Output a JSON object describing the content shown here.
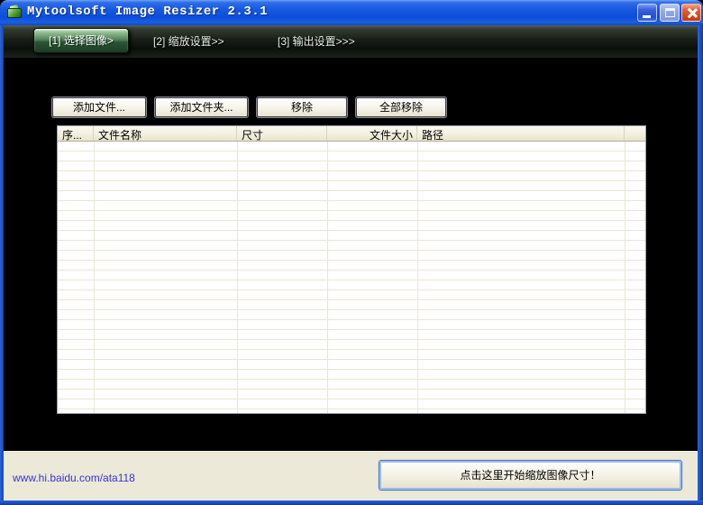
{
  "window": {
    "title": "Mytoolsoft Image Resizer 2.3.1",
    "icon": "app-logo-green-resizer",
    "controls": {
      "minimize": "minimize-icon",
      "maximize": "maximize-icon",
      "close": "close-icon"
    }
  },
  "tabs": [
    {
      "label": "[1] 选择图像>",
      "active": true
    },
    {
      "label": "[2] 缩放设置>>",
      "active": false
    },
    {
      "label": "[3] 输出设置>>>",
      "active": false
    }
  ],
  "toolbar": {
    "add_files": "添加文件...",
    "add_folder": "添加文件夹...",
    "remove": "移除",
    "remove_all": "全部移除"
  },
  "table": {
    "columns": [
      "序...",
      "文件名称",
      "尺寸",
      "文件大小",
      "路径"
    ],
    "rows": []
  },
  "footer": {
    "link": "www.hi.baidu.com/ata118",
    "start_button": "点击这里开始缩放图像尺寸！"
  },
  "colors": {
    "titlebar_blue": "#1658e0",
    "border_blue": "#1e55d4",
    "tabbar_dark": "#141a14",
    "active_tab_green": "#2b5535",
    "content_black": "#000000",
    "panel_beige": "#ece9d8",
    "link_blue": "#3434cd",
    "close_red": "#d4491d"
  }
}
